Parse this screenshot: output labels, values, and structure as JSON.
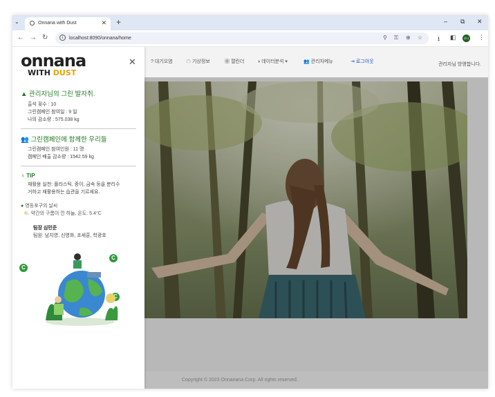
{
  "browser": {
    "tab_title": "Onnana with Dust",
    "url": "localhost:8090/onnana/home",
    "window": {
      "minimize": "–",
      "restore": "⧉",
      "close": "✕"
    },
    "profile_initials": "온나"
  },
  "nav": {
    "items": [
      "? 대기오염",
      "기상정보",
      "캘린더",
      "데이터분석",
      "관리자메뉴",
      "로그아웃"
    ],
    "greeting": "관리자님 방앵합니다."
  },
  "sidebar": {
    "logo_top": "onnana",
    "logo_with": "WITH",
    "logo_dust": "DUST",
    "section1": {
      "title": "관리자님의 그린 발자취.",
      "lines": [
        "출석 횟수 : 10",
        "그린캠페인 참여일 : 9 일",
        "나의 감소량 : 575.038 kg"
      ]
    },
    "section2": {
      "title": "그린캠페인에 함께한 우리들",
      "lines": [
        "그린캠페인 참여인원 : 11 명",
        "캠페인 배출 감소량 : 1542.59 kg"
      ]
    },
    "tip": {
      "label": "TIP",
      "lines": [
        "재활용 실천: 플라스틱, 종이, 금속 등을 분리수",
        "거하고 재활용하는 습관을 기르세요."
      ]
    },
    "weather": {
      "location": "영등포구의 날씨",
      "desc": "약간의 구름이 낀 하늘, 온도: 5.4°C"
    },
    "team": {
      "leader": "팀장 심민준",
      "members": "팀원: 남지영, 신영화, 조세훈, 학광호"
    }
  },
  "footer": "Copyright © 2023 Onnanana Corp. All rights reserved.",
  "colors": {
    "accent_green": "#1f7a1f",
    "logout_blue": "#1a56c8",
    "dust_yellow": "#e9a100"
  },
  "icons": [
    "tab-dropdown-icon",
    "back-arrow-icon",
    "forward-arrow-icon",
    "reload-icon",
    "info-icon",
    "location-icon",
    "key-icon",
    "zoom-icon",
    "star-icon",
    "download-icon",
    "sidepanel-icon",
    "kebab-menu-icon"
  ]
}
